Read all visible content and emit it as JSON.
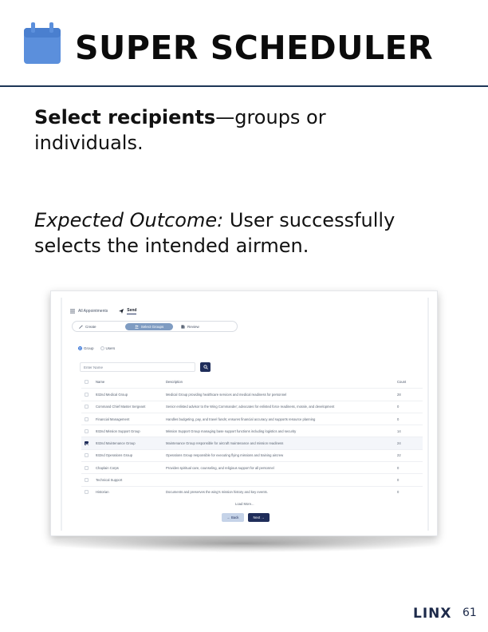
{
  "header": {
    "title": "SUPER SCHEDULER",
    "icon": "calendar-icon",
    "icon_color": "#5b8fdc",
    "rule_color": "#1d3557"
  },
  "body": {
    "instruction_bold": "Select recipients",
    "instruction_rest": "—groups or individuals.",
    "outcome_label": "Expected Outcome:",
    "outcome_text": " User successfully selects the intended airmen."
  },
  "screenshot": {
    "nav": {
      "all_appointments": "All Appointments",
      "send": "Send"
    },
    "steps": [
      {
        "label": "Create",
        "icon": "wand-icon",
        "active": false
      },
      {
        "label": "Select Groups",
        "icon": "users-icon",
        "active": true
      },
      {
        "label": "Review",
        "icon": "review-icon",
        "active": false
      }
    ],
    "radio_options": [
      {
        "label": "Group",
        "checked": true
      },
      {
        "label": "Users",
        "checked": false
      }
    ],
    "search_placeholder": "Enter Name",
    "table": {
      "columns": [
        "Name",
        "Description",
        "Count"
      ],
      "rows": [
        {
          "name": "932nd Medical Group",
          "description": "Medical Group providing healthcare services and medical readiness for personnel",
          "count": "28",
          "checked": false
        },
        {
          "name": "Command Chief Master Sergeant",
          "description": "Senior enlisted advisor to the Wing Commander; advocates for enlisted force readiness, morale, and development",
          "count": "0",
          "checked": false
        },
        {
          "name": "Financial Management",
          "description": "Handles budgeting, pay, and travel funds; ensures financial accuracy and supports resource planning",
          "count": "0",
          "checked": false
        },
        {
          "name": "932nd Mission Support Group",
          "description": "Mission Support Group managing base support functions including logistics and security",
          "count": "14",
          "checked": false
        },
        {
          "name": "932nd Maintenance Group",
          "description": "Maintenance Group responsible for aircraft maintenance and mission readiness",
          "count": "24",
          "checked": true
        },
        {
          "name": "932nd Operations Group",
          "description": "Operations Group responsible for executing flying missions and training aircrew",
          "count": "22",
          "checked": false
        },
        {
          "name": "Chaplain Corps",
          "description": "Provides spiritual care, counseling, and religious support for all personnel",
          "count": "0",
          "checked": false
        },
        {
          "name": "Technical Support",
          "description": "",
          "count": "0",
          "checked": false
        },
        {
          "name": "Historian",
          "description": "Documents and preserves the wing's mission history and key events.",
          "count": "0",
          "checked": false
        }
      ]
    },
    "load_more": "Load More...",
    "back_label": "← Back",
    "next_label": "Next →",
    "accent_color": "#1f2d5a"
  },
  "footer": {
    "logo": "LINX",
    "page_number": "61"
  }
}
